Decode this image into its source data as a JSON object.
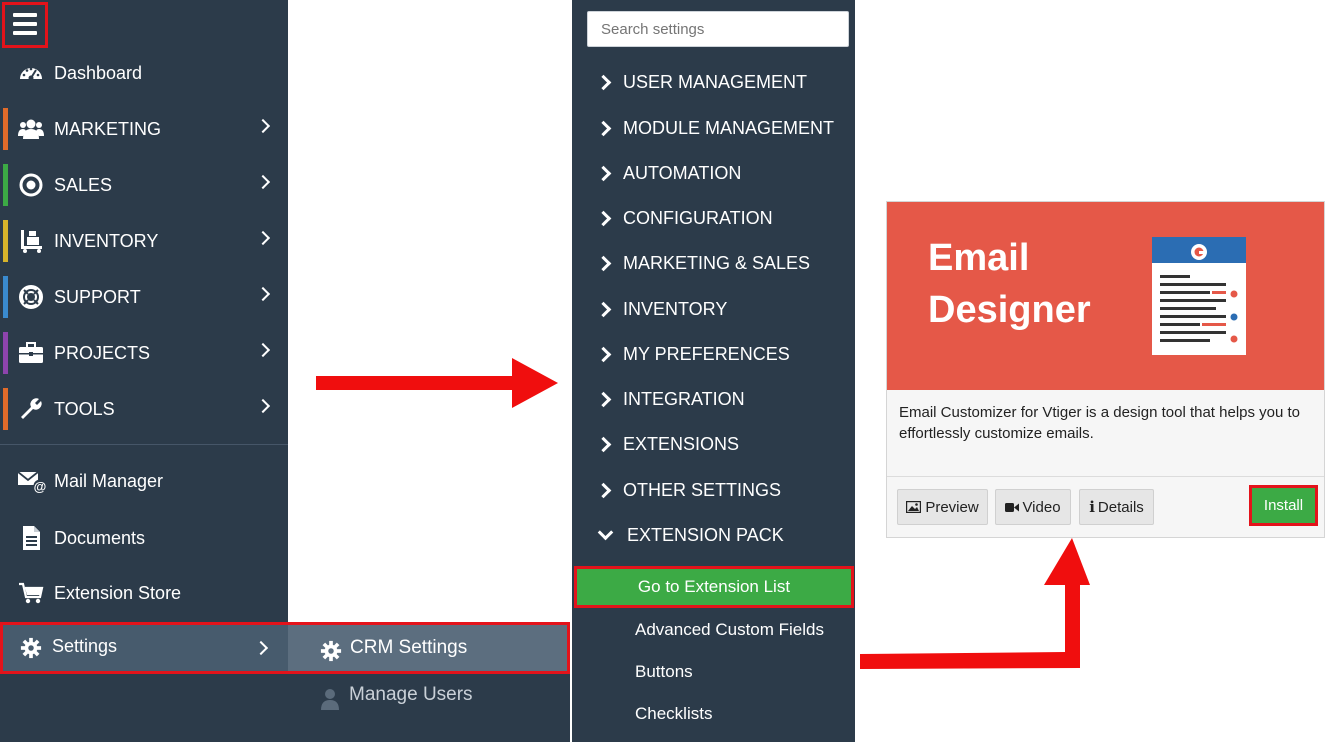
{
  "sidebar": {
    "items": [
      {
        "label": "Dashboard",
        "icon": "dashboard-icon",
        "accent": null
      },
      {
        "label": "MARKETING",
        "icon": "users-icon",
        "accent": "#e06b2a"
      },
      {
        "label": "SALES",
        "icon": "target-icon",
        "accent": "#3caa45"
      },
      {
        "label": "INVENTORY",
        "icon": "cart-trolley-icon",
        "accent": "#d6b32b"
      },
      {
        "label": "SUPPORT",
        "icon": "lifebuoy-icon",
        "accent": "#3a8bd0"
      },
      {
        "label": "PROJECTS",
        "icon": "briefcase-icon",
        "accent": "#8e44ad"
      },
      {
        "label": "TOOLS",
        "icon": "wrench-icon",
        "accent": "#e06b2a"
      }
    ],
    "secondary": [
      {
        "label": "Mail Manager",
        "icon": "mail-at-icon"
      },
      {
        "label": "Documents",
        "icon": "document-icon"
      },
      {
        "label": "Extension Store",
        "icon": "cart-icon"
      }
    ],
    "settings_label": "Settings"
  },
  "settings_submenu": {
    "crm_settings": "CRM Settings",
    "manage_users": "Manage Users"
  },
  "settings_panel": {
    "search_placeholder": "Search settings",
    "sections": [
      "USER MANAGEMENT",
      "MODULE MANAGEMENT",
      "AUTOMATION",
      "CONFIGURATION",
      "MARKETING & SALES",
      "INVENTORY",
      "MY PREFERENCES",
      "INTEGRATION",
      "EXTENSIONS",
      "OTHER SETTINGS"
    ],
    "expanded_section": "EXTENSION PACK",
    "sub_items": [
      "Go to Extension List",
      "Advanced Custom Fields",
      "Buttons",
      "Checklists"
    ]
  },
  "extension_card": {
    "title_line1": "Email",
    "title_line2": "Designer",
    "description": "Email Customizer for Vtiger is a design tool that helps you to effortlessly customize emails.",
    "buttons": {
      "preview": "Preview",
      "video": "Video",
      "details": "Details",
      "install": "Install"
    }
  },
  "colors": {
    "sidebar_bg": "#2c3b4a",
    "highlight_red": "#e3131b",
    "install_green": "#3caa45",
    "banner_red": "#e55848"
  }
}
